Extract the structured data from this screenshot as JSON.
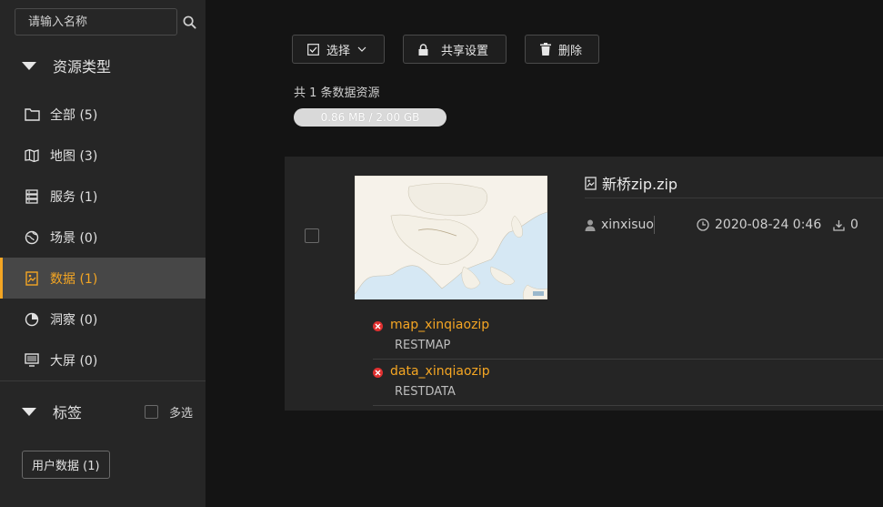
{
  "search": {
    "placeholder": "请输入名称"
  },
  "sidebar": {
    "resource_type_title": "资源类型",
    "items": [
      {
        "icon": "folder-icon",
        "label": "全部 (5)"
      },
      {
        "icon": "map-icon",
        "label": "地图 (3)"
      },
      {
        "icon": "server-icon",
        "label": "服务 (1)"
      },
      {
        "icon": "scene-icon",
        "label": "场景 (0)"
      },
      {
        "icon": "data-icon",
        "label": "数据 (1)",
        "active": true
      },
      {
        "icon": "insight-icon",
        "label": "洞察 (0)"
      },
      {
        "icon": "screen-icon",
        "label": "大屏 (0)"
      }
    ],
    "tags_title": "标签",
    "multi_select_label": "多选",
    "tag_button": "用户数据 (1)"
  },
  "toolbar": {
    "select_label": "选择",
    "share_label": "共享设置",
    "delete_label": "删除"
  },
  "summary": {
    "count_text": "共 1 条数据资源",
    "storage_label": "0.86 MB / 2.00 GB",
    "storage_fraction": 0.0004
  },
  "resource": {
    "title": "新桥zip.zip",
    "owner": "xinxisuo",
    "date": "2020-08-24 0:46",
    "downloads": "0",
    "sub_items": [
      {
        "name": "map_xinqiaozip",
        "type": "RESTMAP"
      },
      {
        "name": "data_xinqiaozip",
        "type": "RESTDATA"
      }
    ]
  },
  "colors": {
    "accent": "#f5a623",
    "sidebar_bg": "#262626",
    "main_bg": "#141414",
    "error": "#e03030"
  }
}
